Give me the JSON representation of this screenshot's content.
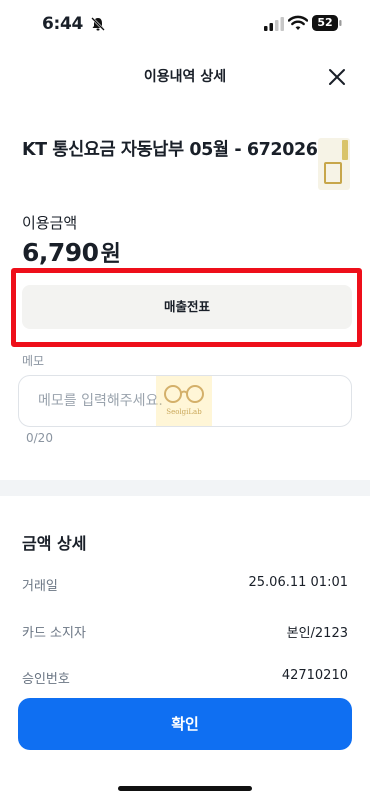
{
  "status_bar": {
    "time": "6:44",
    "battery": "52"
  },
  "header": {
    "title": "이용내역 상세"
  },
  "transaction": {
    "title": "KT 통신요금 자동납부 05월 - 672026",
    "amount_label": "이용금액",
    "amount": "6,790",
    "currency_unit": "원"
  },
  "receipt_button": {
    "label": "매출전표"
  },
  "highlight": {
    "color": "#ee0f1a"
  },
  "memo": {
    "label": "메모",
    "placeholder": "메모를 입력해주세요.",
    "value": "",
    "counter": "0/20",
    "watermark_text": "SeolgiLab"
  },
  "details": {
    "heading": "금액 상세",
    "rows": [
      {
        "label": "거래일",
        "value": "25.06.11 01:01"
      },
      {
        "label": "카드 소지자",
        "value": "본인/2123"
      },
      {
        "label": "승인번호",
        "value": "42710210"
      }
    ]
  },
  "confirm_button": {
    "label": "확인",
    "color": "#0f6ff2"
  },
  "icons": {
    "close": "close-icon",
    "bell_off": "bell-off-icon",
    "signal": "cellular-signal-icon",
    "wifi": "wifi-icon",
    "battery": "battery-icon"
  }
}
